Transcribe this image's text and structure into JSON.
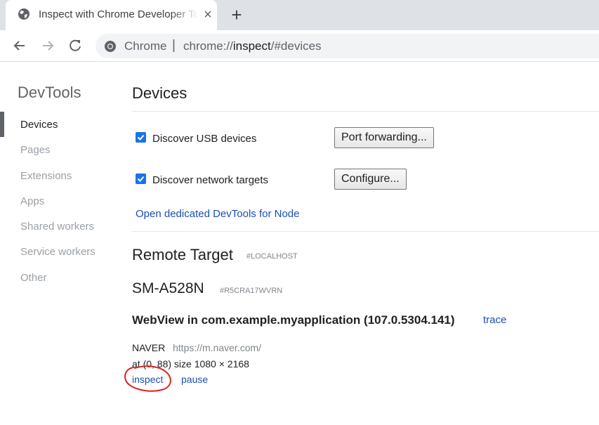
{
  "browser": {
    "tab": {
      "title": "Inspect with Chrome Developer Tools",
      "favicon": "globe-icon",
      "close": "×"
    },
    "new_tab": "+",
    "omnibox": {
      "site_label": "Chrome",
      "separator": "|",
      "url_scheme": "chrome://",
      "url_host": "inspect",
      "url_path": "/#devices",
      "icon": "chrome-icon"
    },
    "nav_icons": [
      "back-arrow-icon",
      "forward-arrow-icon",
      "reload-icon"
    ]
  },
  "sidebar": {
    "title": "DevTools",
    "items": [
      {
        "label": "Devices",
        "selected": true
      },
      {
        "label": "Pages",
        "selected": false
      },
      {
        "label": "Extensions",
        "selected": false
      },
      {
        "label": "Apps",
        "selected": false
      },
      {
        "label": "Shared workers",
        "selected": false
      },
      {
        "label": "Service workers",
        "selected": false
      },
      {
        "label": "Other",
        "selected": false
      }
    ]
  },
  "main": {
    "title": "Devices",
    "usb": {
      "label": "Discover USB devices",
      "checked": true,
      "button": "Port forwarding..."
    },
    "network": {
      "label": "Discover network targets",
      "checked": true,
      "button": "Configure..."
    },
    "node_link": "Open dedicated DevTools for Node",
    "remote": {
      "title": "Remote Target",
      "tag": "#LOCALHOST",
      "device": {
        "name": "SM-A528N",
        "serial": "#R5CRA17WVRN",
        "webview": {
          "title": "WebView in com.example.myapplication (107.0.5304.141)",
          "trace": "trace",
          "page": {
            "name": "NAVER",
            "url": "https://m.naver.com/",
            "position": "at (0, 88)  size 1080 × 2168",
            "inspect": "inspect",
            "pause": "pause"
          }
        }
      }
    }
  },
  "colors": {
    "link": "#1a4fb4",
    "checkbox": "#1a73e8",
    "annotation": "#e0201e",
    "tabstrip": "#dee1e6"
  }
}
